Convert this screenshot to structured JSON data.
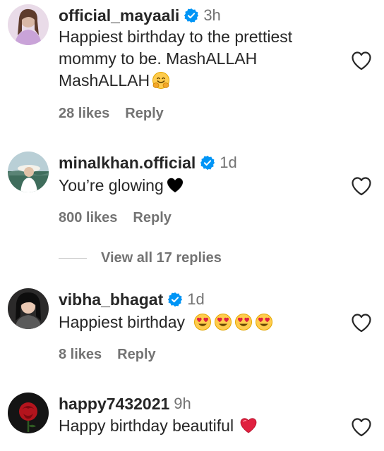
{
  "comments": [
    {
      "username": "official_mayaali",
      "verified": true,
      "time": "3h",
      "lines": [
        "Happiest birthday to the prettiest",
        "mommy to be. MashALLAH",
        "MashALLAH"
      ],
      "emoji": "hugging-face",
      "likes": "28 likes",
      "reply": "Reply"
    },
    {
      "username": "minalkhan.official",
      "verified": true,
      "time": "1d",
      "text": "You’re glowing",
      "emoji": "black-heart",
      "likes": "800 likes",
      "reply": "Reply"
    },
    {
      "username": "vibha_bhagat",
      "verified": true,
      "time": "1d",
      "text": "Happiest birthday",
      "emoji": "heart-eyes x4",
      "likes": "8 likes",
      "reply": "Reply"
    },
    {
      "username": "happy7432021",
      "verified": false,
      "time": "9h",
      "text": "Happy birthday beautiful",
      "emoji": "red-heart"
    }
  ],
  "view_replies": "View all 17 replies",
  "colors": {
    "primary_text": "#262626",
    "secondary_text": "#737373",
    "verified_blue": "#0095f6"
  }
}
